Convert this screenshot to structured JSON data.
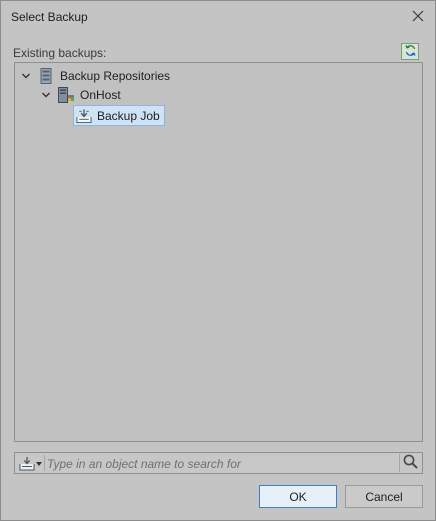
{
  "window": {
    "title": "Select Backup",
    "close_icon": "close-icon"
  },
  "section": {
    "label": "Existing backups:",
    "refresh_icon": "refresh-icon"
  },
  "tree": {
    "nodes": [
      {
        "label": "Backup Repositories",
        "icon": "repository-icon",
        "expanded": true,
        "level": 0
      },
      {
        "label": "OnHost",
        "icon": "host-icon",
        "expanded": true,
        "level": 1
      },
      {
        "label": "Backup Job",
        "icon": "backup-job-icon",
        "selected": true,
        "level": 2
      }
    ]
  },
  "search": {
    "placeholder": "Type in an object name to search for",
    "value": "",
    "type_icon": "object-type-icon",
    "search_icon": "search-icon"
  },
  "buttons": {
    "ok_label": "OK",
    "cancel_label": "Cancel"
  },
  "colors": {
    "selection": "#cfe3f6",
    "ok_border": "#3c7fc7"
  }
}
